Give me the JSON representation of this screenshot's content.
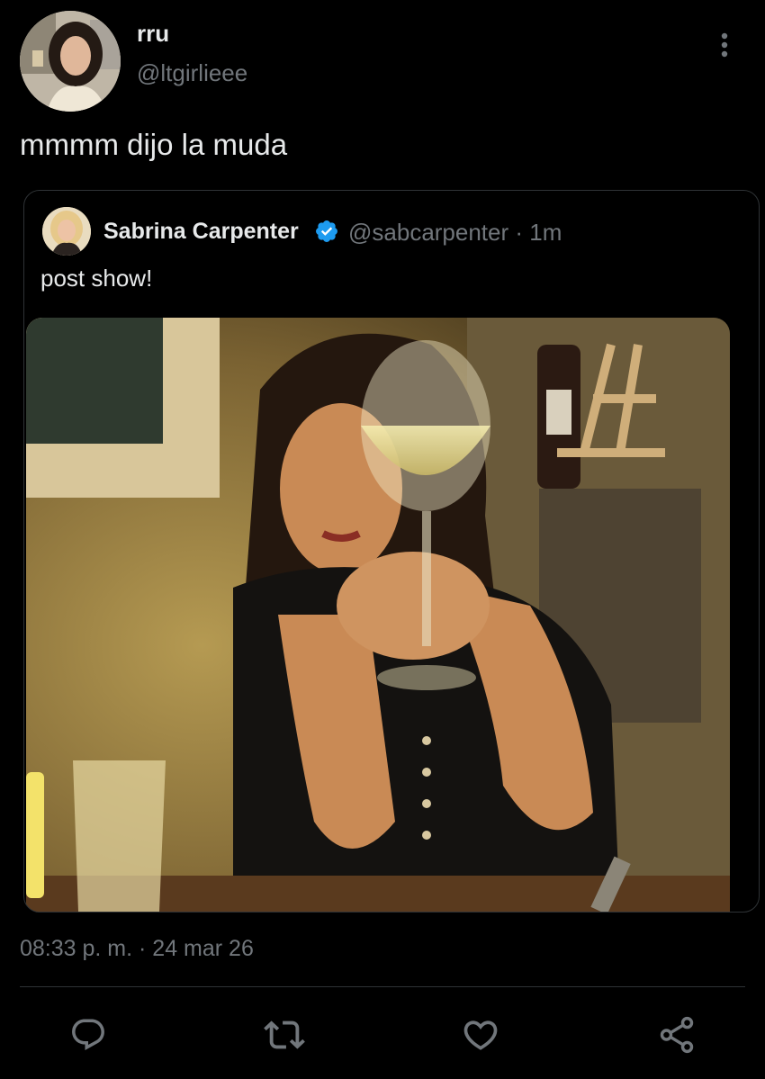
{
  "tweet": {
    "author": {
      "display_name": "rru",
      "handle": "@ltgirlieee"
    },
    "text": "mmmm dijo la muda",
    "timestamp": "08:33 p. m. · 24 mar 26"
  },
  "quoted_tweet": {
    "author": {
      "display_name": "Sabrina Carpenter",
      "handle_time": "@sabcarpenter · 1m",
      "verified": true
    },
    "text": "post show!"
  },
  "icons": {
    "more": "more-vertical-icon",
    "reply": "reply-icon",
    "retweet": "retweet-icon",
    "like": "heart-icon",
    "share": "share-icon",
    "verified": "verified-badge-icon"
  },
  "colors": {
    "background": "#000000",
    "text_primary": "#e7e9ea",
    "text_secondary": "#71767b",
    "verified": "#1d9bf0",
    "border": "#2f3336"
  }
}
